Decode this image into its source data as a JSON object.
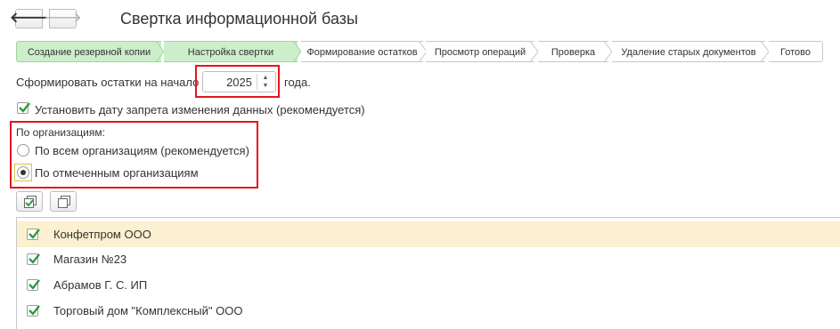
{
  "nav": {
    "back_icon": "arrow-left-icon",
    "forward_icon": "arrow-right-icon"
  },
  "window": {
    "title": "Свертка информационной базы"
  },
  "steps": [
    {
      "label": "Создание резервной копии",
      "state": "done"
    },
    {
      "label": "Настройка свертки",
      "state": "done"
    },
    {
      "label": "Формирование остатков",
      "state": "pending"
    },
    {
      "label": "Просмотр операций",
      "state": "pending"
    },
    {
      "label": "Проверка",
      "state": "pending"
    },
    {
      "label": "Удаление старых документов",
      "state": "pending"
    },
    {
      "label": "Готово",
      "state": "pending"
    }
  ],
  "year_row": {
    "label_before": "Сформировать остатки на начало",
    "year_value": "2025",
    "label_after": "года."
  },
  "lock_date": {
    "label": "Установить дату запрета изменения данных (рекомендуется)",
    "checked": true
  },
  "orgs": {
    "group_label": "По организациям:",
    "option_all": "По всем организациям (рекомендуется)",
    "option_selected": "По отмеченным организациям",
    "selected": "option_selected"
  },
  "toolbar": {
    "check_all_icon": "check-all-icon",
    "uncheck_all_icon": "uncheck-all-icon"
  },
  "organizations": [
    {
      "name": "Конфетпром ООО",
      "checked": true,
      "highlighted": true
    },
    {
      "name": "Магазин №23",
      "checked": true,
      "highlighted": false
    },
    {
      "name": "Абрамов Г. С. ИП",
      "checked": true,
      "highlighted": false
    },
    {
      "name": "Торговый дом \"Комплексный\" ООО",
      "checked": true,
      "highlighted": false
    }
  ],
  "colors": {
    "step_done_bg": "#cdeecb",
    "highlight_row": "#fbf0d0",
    "annotation_red": "#e4151f",
    "check_green": "#2e9a3e"
  }
}
